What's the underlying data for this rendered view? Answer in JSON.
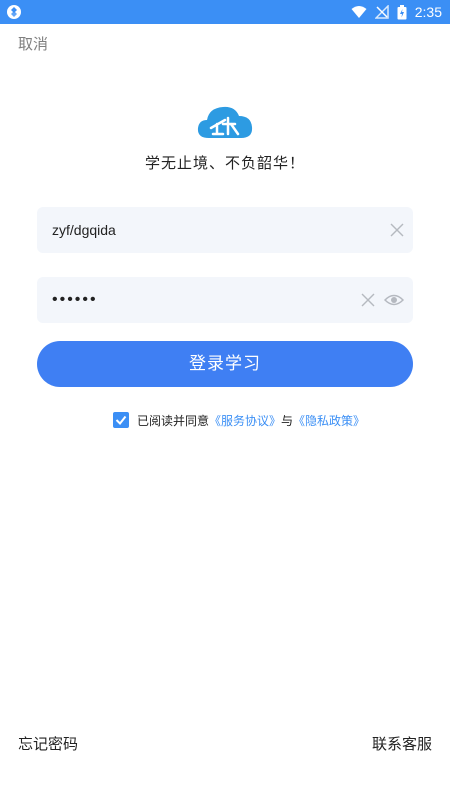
{
  "status_bar": {
    "time": "2:35"
  },
  "header": {
    "cancel_label": "取消"
  },
  "brand": {
    "logo_text": "企大",
    "slogan": "学无止境、不负韶华！"
  },
  "form": {
    "username_value": "zyf/dgqida",
    "password_value": "••••••"
  },
  "login_button_label": "登录学习",
  "agreement": {
    "prefix": "已阅读并同意",
    "service_link": "《服务协议》",
    "and": "与",
    "privacy_link": "《隐私政策》"
  },
  "footer": {
    "forgot_password": "忘记密码",
    "contact_support": "联系客服"
  },
  "colors": {
    "accent": "#3b8ff5",
    "button": "#3f7ff3"
  }
}
